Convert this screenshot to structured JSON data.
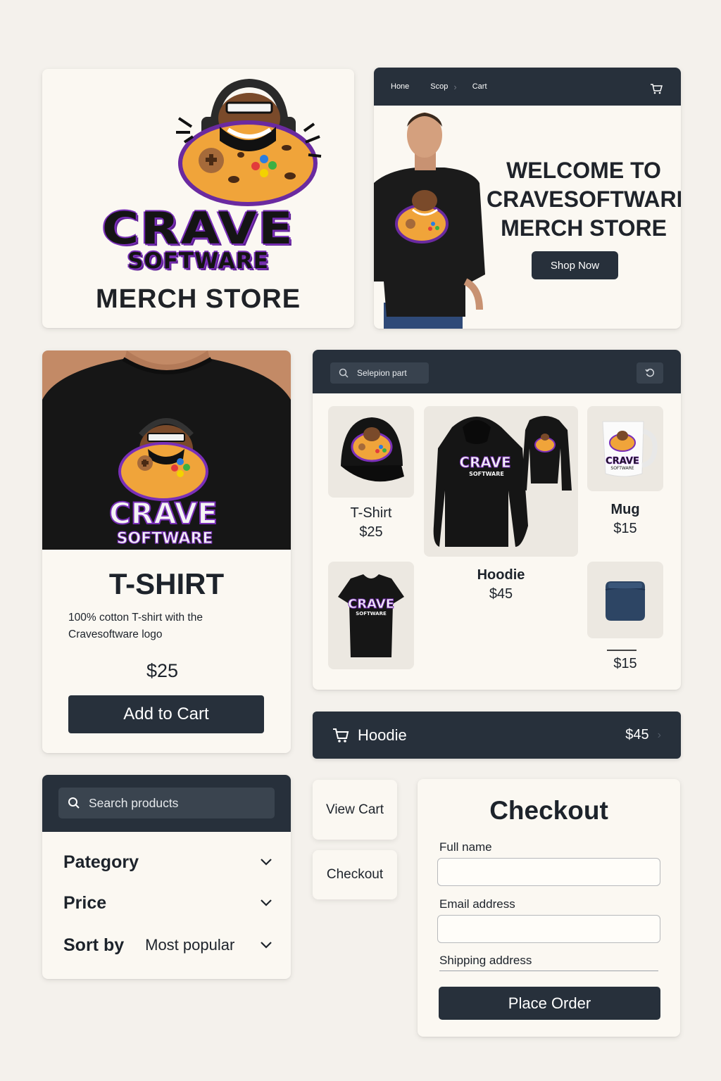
{
  "brand": {
    "logo_text_1": "CRAVE",
    "logo_text_2": "SOFTWARE",
    "subtitle": "MERCH STORE"
  },
  "hero": {
    "nav": [
      "Hone",
      "Scop",
      "Cart"
    ],
    "title_lines": [
      "WELCOME TO",
      "CRAVESOFTWARE",
      "MERCH STORE"
    ],
    "cta_label": "Shop Now",
    "cart_icon": "cart-icon"
  },
  "product_detail": {
    "name": "T-SHIRT",
    "description": "100% cotton T-shirt with the Cravesoftware logo",
    "price": "$25",
    "add_to_cart_label": "Add to Cart"
  },
  "grid": {
    "search_text": "Selepion part",
    "refresh_icon": "refresh-icon",
    "items": [
      {
        "name": "T-Shirt",
        "price": "$25"
      },
      {
        "name": "Hoodie",
        "price": "$45"
      },
      {
        "name": "Mug",
        "price": "$15"
      },
      {
        "name": "",
        "price": "$15"
      }
    ]
  },
  "cart_bar": {
    "item": "Hoodie",
    "price": "$45"
  },
  "filters": {
    "search_placeholder": "Search products",
    "category_label": "Pategory",
    "price_label": "Price",
    "sort_label": "Sort by",
    "sort_value": "Most popular"
  },
  "actions": {
    "view_cart": "View Cart",
    "checkout": "Checkout"
  },
  "checkout_form": {
    "title": "Checkout",
    "full_name_label": "Full name",
    "email_label": "Email address",
    "shipping_label": "Shipping address",
    "place_order_label": "Place Order"
  },
  "colors": {
    "navy": "#27303b",
    "card": "#fbf8f2",
    "background": "#f4f1ec",
    "accent_purple": "#7a2fb8",
    "cookie_orange": "#f0a43a"
  }
}
